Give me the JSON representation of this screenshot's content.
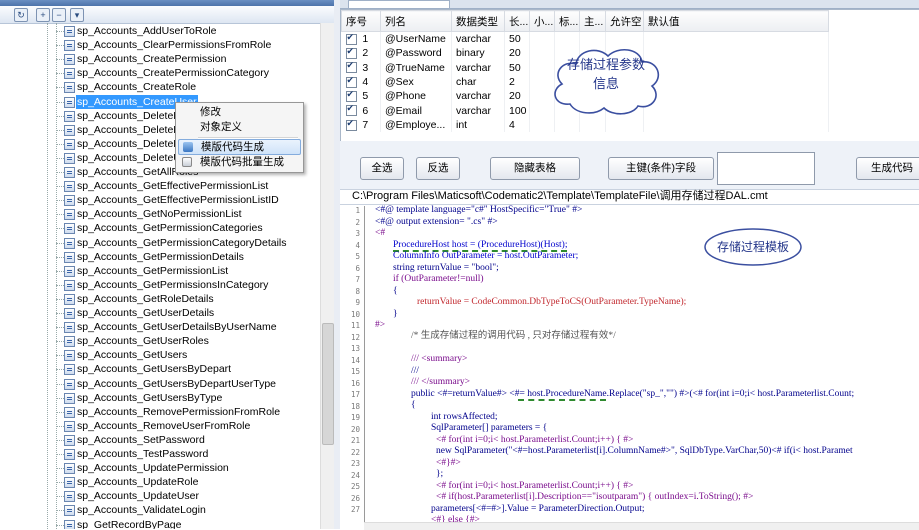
{
  "procedure_tree": {
    "items": [
      "sp_Accounts_AddUserToRole",
      "sp_Accounts_ClearPermissionsFromRole",
      "sp_Accounts_CreatePermission",
      "sp_Accounts_CreatePermissionCategory",
      "sp_Accounts_CreateRole",
      "sp_Accounts_CreateUser",
      "sp_Accounts_DeleteP",
      "sp_Accounts_DeleteP",
      "sp_Accounts_DeleteR",
      "sp_Accounts_DeleteU",
      "sp_Accounts_GetAllRoles",
      "sp_Accounts_GetEffectivePermissionList",
      "sp_Accounts_GetEffectivePermissionListID",
      "sp_Accounts_GetNoPermissionList",
      "sp_Accounts_GetPermissionCategories",
      "sp_Accounts_GetPermissionCategoryDetails",
      "sp_Accounts_GetPermissionDetails",
      "sp_Accounts_GetPermissionList",
      "sp_Accounts_GetPermissionsInCategory",
      "sp_Accounts_GetRoleDetails",
      "sp_Accounts_GetUserDetails",
      "sp_Accounts_GetUserDetailsByUserName",
      "sp_Accounts_GetUserRoles",
      "sp_Accounts_GetUsers",
      "sp_Accounts_GetUsersByDepart",
      "sp_Accounts_GetUsersByDepartUserType",
      "sp_Accounts_GetUsersByType",
      "sp_Accounts_RemovePermissionFromRole",
      "sp_Accounts_RemoveUserFromRole",
      "sp_Accounts_SetPassword",
      "sp_Accounts_TestPassword",
      "sp_Accounts_UpdatePermission",
      "sp_Accounts_UpdateRole",
      "sp_Accounts_UpdateUser",
      "sp_Accounts_ValidateLogin",
      "sp_GetRecordByPage"
    ],
    "selected_index": 5,
    "toolbar_icons": [
      "refresh-icon",
      "expand-icon",
      "collapse-icon"
    ]
  },
  "context_menu": {
    "items": [
      "修改",
      "对象定义",
      "模版代码生成",
      "模版代码批量生成"
    ],
    "highlighted_index": 2
  },
  "param_grid": {
    "columns": [
      "序号",
      "列名",
      "数据类型",
      "长...",
      "小...",
      "标...",
      "主...",
      "允许空",
      "默认值"
    ],
    "rows": [
      {
        "checked": true,
        "no": "1",
        "name": "@UserName",
        "type": "varchar",
        "len": "50"
      },
      {
        "checked": true,
        "no": "2",
        "name": "@Password",
        "type": "binary",
        "len": "20"
      },
      {
        "checked": true,
        "no": "3",
        "name": "@TrueName",
        "type": "varchar",
        "len": "50"
      },
      {
        "checked": true,
        "no": "4",
        "name": "@Sex",
        "type": "char",
        "len": "2"
      },
      {
        "checked": true,
        "no": "5",
        "name": "@Phone",
        "type": "varchar",
        "len": "20"
      },
      {
        "checked": true,
        "no": "6",
        "name": "@Email",
        "type": "varchar",
        "len": "100"
      },
      {
        "checked": true,
        "no": "7",
        "name": "@Employe...",
        "type": "int",
        "len": "4"
      }
    ]
  },
  "annotations": {
    "cloud": [
      "存储过程参数",
      "信息"
    ],
    "oval": "存储过程模板"
  },
  "buttons": {
    "select_all": "全选",
    "invert": "反选",
    "hide_grid": "隐藏表格",
    "key_field": "主键(条件)字段",
    "generate": "生成代码"
  },
  "template_path": "C:\\Program Files\\Maticsoft\\Codematic2\\Template\\TemplateFile\\调用存储过程DAL.cmt",
  "code_line_numbers": [
    "1",
    "2",
    "3",
    "4",
    "5",
    "6",
    "7",
    "8",
    "9",
    "10",
    "11",
    "12",
    "13",
    "14",
    "15",
    "16",
    "17",
    "18",
    "19",
    "20",
    "21",
    "22",
    "23",
    "24",
    "25",
    "26",
    "27"
  ],
  "code": {
    "l1a": "<#@ template language=\"c#\" HostSpecific=\"True\" #>",
    "l2a": "<#@ output extension= \".cs\" #>",
    "l3a": "<#",
    "l4a": "ProcedureHost host = (ProcedureHost)(Host);",
    "l5a": "ColumnInfo OutParameter = host.OutParameter;",
    "l6a": "string returnValue = \"bool\";",
    "l7a": "if (OutParameter!=null)",
    "l8a": "{",
    "l9a": "returnValue = CodeCommon.DbTypeToCS(OutParameter.TypeName);",
    "l10a": "}",
    "l11a": "#>",
    "l12a": "/* 生成存储过程的调用代码 , 只对存储过程有效*/",
    "l14a": "/// <summary>",
    "l15a": "///",
    "l16a": "/// </summary>",
    "l17a": "public <#=returnValue#> <#= host.ProcedureName.Replace(\"sp_\",\"\") #>(<# for(int i=0;i< host.Parameterlist.Count;",
    "l18a": "{",
    "l19a": "int rowsAffected;",
    "l20a": "SqlParameter[] parameters = {",
    "l21a": "<# for(int i=0;i< host.Parameterlist.Count;i++) { #>",
    "l22a": "new SqlParameter(\"<#=host.Parameterlist[i].ColumnName#>\", SqlDbType.VarChar,50)<# if(i< host.Paramet",
    "l23a": "<#}#>",
    "l24a": "};",
    "l25a": "<# for(int i=0;i< host.Parameterlist.Count;i++) { #>",
    "l26a": "<# if(host.Parameterlist[i].Description==\"isoutparam\") { outIndex=i.ToString(); #>",
    "l27a": "parameters[<#=#>].Value = ParameterDirection.Output;",
    "l28a": "<#} else {#>"
  }
}
